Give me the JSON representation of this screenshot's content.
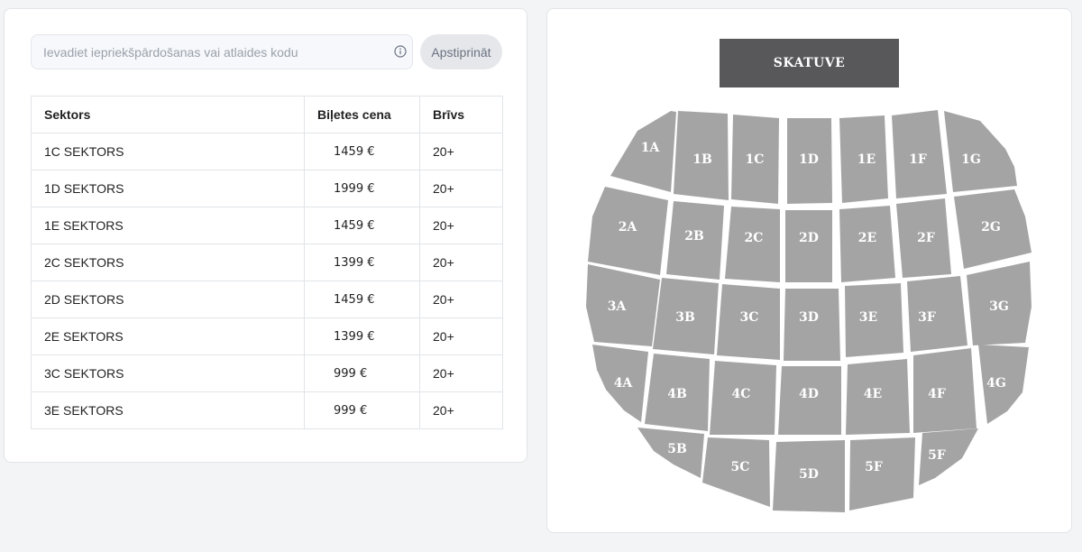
{
  "promo": {
    "placeholder": "Ievadiet iepriekšpārdošanas vai atlaides kodu",
    "confirm_label": "Apstiprināt",
    "info_icon": "info-circle-icon"
  },
  "table": {
    "headers": [
      "Sektors",
      "Biļetes cena",
      "Brīvs"
    ],
    "rows": [
      {
        "sector": "1C SEKTORS",
        "price": "1459 €",
        "free": "20+"
      },
      {
        "sector": "1D SEKTORS",
        "price": "1999 €",
        "free": "20+"
      },
      {
        "sector": "1E SEKTORS",
        "price": "1459 €",
        "free": "20+"
      },
      {
        "sector": "2C SEKTORS",
        "price": "1399 €",
        "free": "20+"
      },
      {
        "sector": "2D SEKTORS",
        "price": "1459 €",
        "free": "20+"
      },
      {
        "sector": "2E SEKTORS",
        "price": "1399 €",
        "free": "20+"
      },
      {
        "sector": "3C SEKTORS",
        "price": "999 €",
        "free": "20+"
      },
      {
        "sector": "3E SEKTORS",
        "price": "999 €",
        "free": "20+"
      }
    ]
  },
  "seatmap": {
    "stage_label": "SKATUVE",
    "colors": {
      "sector_fill": "#a4a4a4",
      "stage_fill": "#58585a",
      "label": "#ffffff"
    },
    "rows": [
      [
        "1A",
        "1B",
        "1C",
        "1D",
        "1E",
        "1F",
        "1G"
      ],
      [
        "2A",
        "2B",
        "2C",
        "2D",
        "2E",
        "2F",
        "2G"
      ],
      [
        "3A",
        "3B",
        "3C",
        "3D",
        "3E",
        "3F",
        "3G"
      ],
      [
        "4A",
        "4B",
        "4C",
        "4D",
        "4E",
        "4F",
        "4G"
      ],
      [
        "5B",
        "5C",
        "5D",
        "5F",
        "5F"
      ]
    ]
  }
}
